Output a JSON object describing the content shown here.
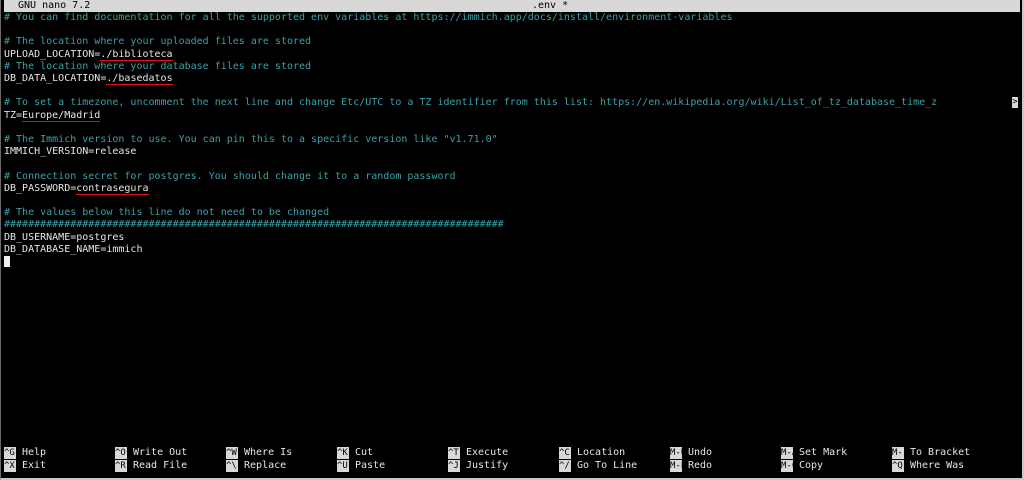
{
  "titlebar": {
    "app": "GNU nano 7.2",
    "file": ".env *"
  },
  "editor": {
    "lines": [
      {
        "id": "l01",
        "kind": "comment",
        "text": "# You can find documentation for all the supported env variables at https://immich.app/docs/install/environment-variables"
      },
      {
        "id": "l02",
        "kind": "blank",
        "text": ""
      },
      {
        "id": "l03",
        "kind": "comment",
        "text": "# The location where your uploaded files are stored"
      },
      {
        "id": "l04",
        "kind": "kv",
        "key": "UPLOAD_LOCATION=",
        "value": "./biblioteca",
        "highlighted": true
      },
      {
        "id": "l05",
        "kind": "comment",
        "text": "# The location where your database files are stored"
      },
      {
        "id": "l06",
        "kind": "kv",
        "key": "DB_DATA_LOCATION=",
        "value": "./basedatos",
        "highlighted": true
      },
      {
        "id": "l07",
        "kind": "blank",
        "text": ""
      },
      {
        "id": "l08",
        "kind": "comment",
        "text": "# To set a timezone, uncomment the next line and change Etc/UTC to a TZ identifier from this list: https://en.wikipedia.org/wiki/List_of_tz_database_time_z",
        "overflow": ">"
      },
      {
        "id": "l09",
        "kind": "kv",
        "key": "TZ=",
        "value": "Europe/Madrid",
        "highlighted": true
      },
      {
        "id": "l10",
        "kind": "blank",
        "text": ""
      },
      {
        "id": "l11",
        "kind": "comment",
        "text": "# The Immich version to use. You can pin this to a specific version like \"v1.71.0\""
      },
      {
        "id": "l12",
        "kind": "plain",
        "text": "IMMICH_VERSION=release"
      },
      {
        "id": "l13",
        "kind": "blank",
        "text": ""
      },
      {
        "id": "l14",
        "kind": "comment",
        "text": "# Connection secret for postgres. You should change it to a random password"
      },
      {
        "id": "l15",
        "kind": "kv",
        "key": "DB_PASSWORD=",
        "value": "contrasegura",
        "highlighted": true
      },
      {
        "id": "l16",
        "kind": "blank",
        "text": ""
      },
      {
        "id": "l17",
        "kind": "comment",
        "text": "# The values below this line do not need to be changed"
      },
      {
        "id": "l18",
        "kind": "comment",
        "text": "###################################################################################"
      },
      {
        "id": "l19",
        "kind": "plain",
        "text": "DB_USERNAME=postgres"
      },
      {
        "id": "l20",
        "kind": "plain",
        "text": "DB_DATABASE_NAME=immich"
      }
    ]
  },
  "shortcuts": [
    {
      "key": "^G",
      "label": "Help"
    },
    {
      "key": "^X",
      "label": "Exit"
    },
    {
      "key": "^O",
      "label": "Write Out"
    },
    {
      "key": "^R",
      "label": "Read File"
    },
    {
      "key": "^W",
      "label": "Where Is"
    },
    {
      "key": "^\\",
      "label": "Replace"
    },
    {
      "key": "^K",
      "label": "Cut"
    },
    {
      "key": "^U",
      "label": "Paste"
    },
    {
      "key": "^T",
      "label": "Execute"
    },
    {
      "key": "^J",
      "label": "Justify"
    },
    {
      "key": "^C",
      "label": "Location"
    },
    {
      "key": "^/",
      "label": "Go To Line"
    },
    {
      "key": "M-U",
      "label": "Undo"
    },
    {
      "key": "M-E",
      "label": "Redo"
    },
    {
      "key": "M-A",
      "label": "Set Mark"
    },
    {
      "key": "M-6",
      "label": "Copy"
    },
    {
      "key": "M-]",
      "label": "To Bracket"
    },
    {
      "key": "^Q",
      "label": "Where Was"
    }
  ],
  "colors": {
    "background": "#000000",
    "comment": "#3aa0a8",
    "text": "#e6e6e6",
    "highlight_underline": "#e01010",
    "bar": "#d8d8d8"
  }
}
